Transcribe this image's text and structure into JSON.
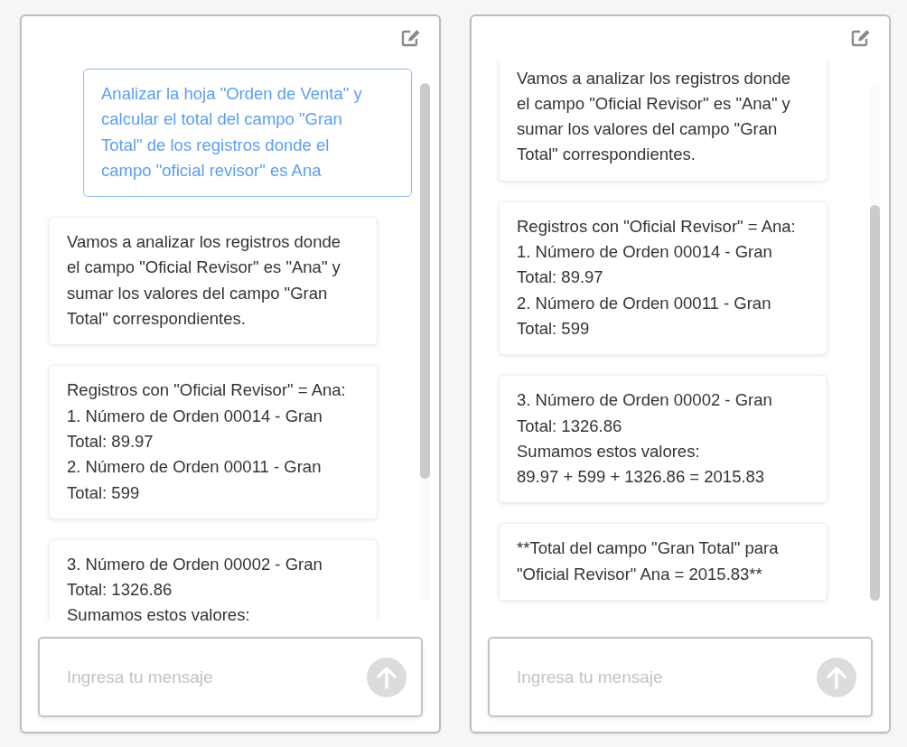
{
  "panels": [
    {
      "scrolled_to_end": false,
      "input": {
        "placeholder": "Ingresa tu mensaje"
      },
      "messages": [
        {
          "kind": "user",
          "lines": [
            "Analizar la hoja \"Orden de Venta\" y",
            "calcular el total del campo \"Gran",
            "Total\" de los registros donde el",
            "campo \"oficial revisor\" es Ana"
          ]
        },
        {
          "kind": "assistant",
          "lines": [
            "Vamos a analizar los registros donde",
            "el campo \"Oficial Revisor\" es \"Ana\" y",
            "sumar los valores del campo \"Gran",
            "Total\" correspondientes."
          ]
        },
        {
          "kind": "assistant",
          "lines": [
            "Registros con \"Oficial Revisor\" = Ana:",
            "1. Número de Orden 00014 - Gran",
            "Total: 89.97",
            "2. Número de Orden 00011 - Gran",
            "Total: 599"
          ]
        },
        {
          "kind": "assistant",
          "lines": [
            "3. Número de Orden 00002 - Gran",
            "Total: 1326.86",
            "Sumamos estos valores:"
          ]
        }
      ]
    },
    {
      "scrolled_to_end": true,
      "input": {
        "placeholder": "Ingresa tu mensaje"
      },
      "messages": [
        {
          "kind": "assistant",
          "lines": [
            "Vamos a analizar los registros donde",
            "el campo \"Oficial Revisor\" es \"Ana\" y",
            "sumar los valores del campo \"Gran",
            "Total\" correspondientes."
          ]
        },
        {
          "kind": "assistant",
          "lines": [
            "Registros con \"Oficial Revisor\" = Ana:",
            "1. Número de Orden 00014 - Gran",
            "Total: 89.97",
            "2. Número de Orden 00011 - Gran",
            "Total: 599"
          ]
        },
        {
          "kind": "assistant",
          "lines": [
            "3. Número de Orden 00002 - Gran",
            "Total: 1326.86",
            "Sumamos estos valores:",
            "89.97 + 599 + 1326.86 = 2015.83"
          ]
        },
        {
          "kind": "assistant",
          "lines": [
            "**Total del campo \"Gran Total\" para",
            "\"Oficial Revisor\" Ana = 2015.83**"
          ]
        }
      ]
    }
  ]
}
